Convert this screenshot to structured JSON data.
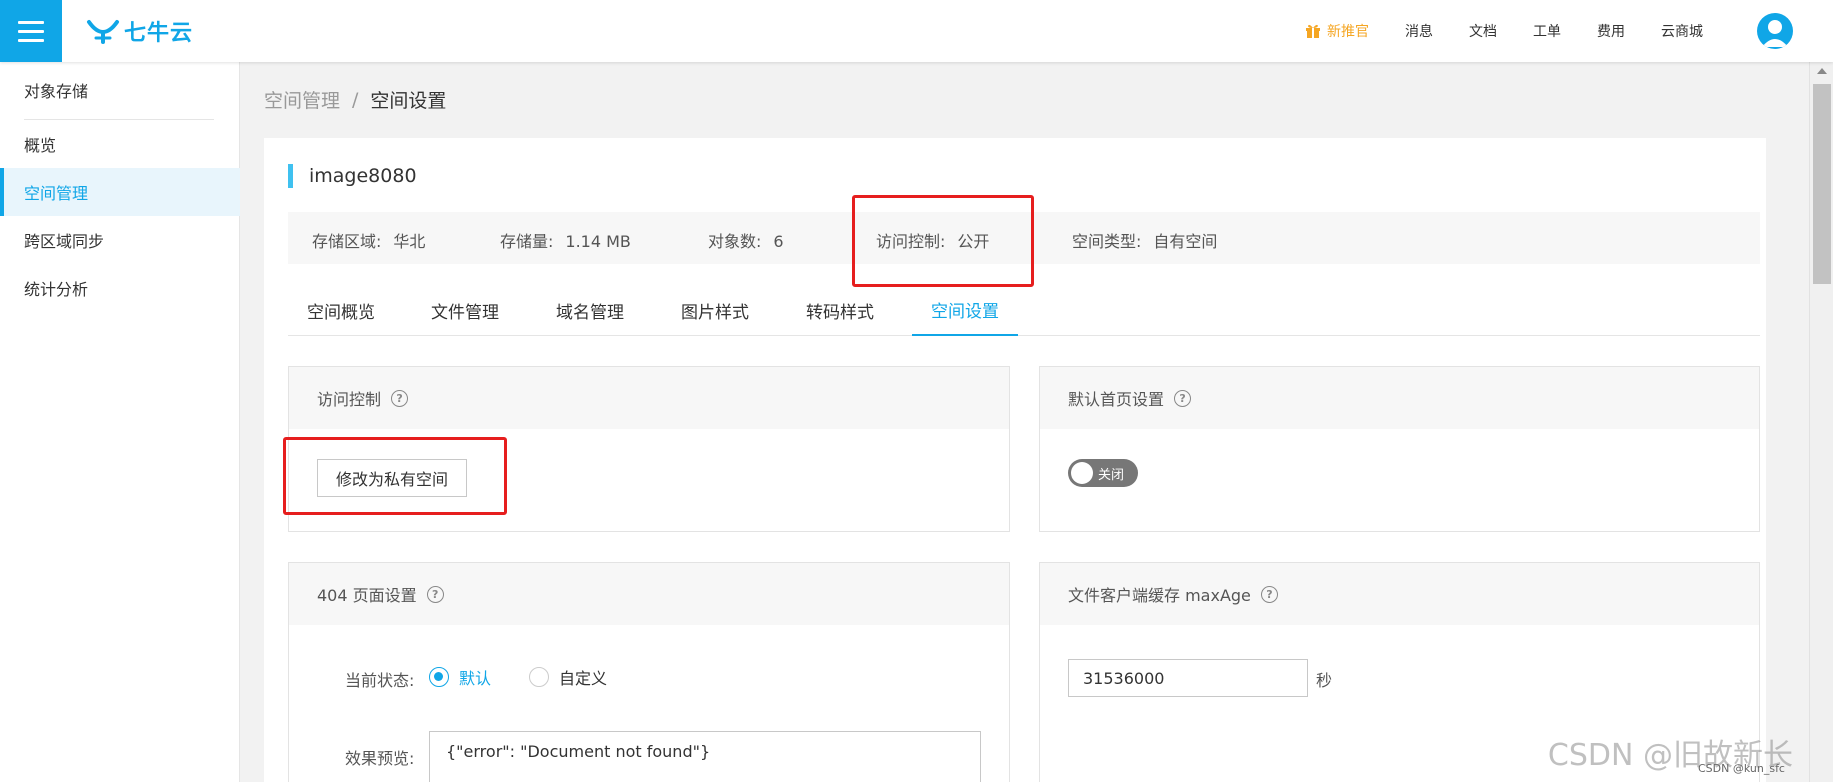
{
  "header": {
    "logo_text": "七牛云",
    "nav": [
      {
        "label": "新推官",
        "promo": true
      },
      {
        "label": "消息"
      },
      {
        "label": "文档"
      },
      {
        "label": "工单"
      },
      {
        "label": "费用"
      },
      {
        "label": "云商城"
      }
    ]
  },
  "sidebar": {
    "title": "对象存储",
    "items": [
      {
        "label": "概览"
      },
      {
        "label": "空间管理",
        "active": true
      },
      {
        "label": "跨区域同步"
      },
      {
        "label": "统计分析"
      }
    ]
  },
  "breadcrumb": {
    "parent": "空间管理",
    "separator": "/",
    "current": "空间设置"
  },
  "bucket": {
    "name": "image8080",
    "info": [
      {
        "key": "存储区域:",
        "value": "华北"
      },
      {
        "key": "存储量:",
        "value": "1.14 MB"
      },
      {
        "key": "对象数:",
        "value": "6"
      },
      {
        "key": "访问控制:",
        "value": "公开"
      },
      {
        "key": "空间类型:",
        "value": "自有空间"
      }
    ]
  },
  "tabs": [
    {
      "label": "空间概览"
    },
    {
      "label": "文件管理"
    },
    {
      "label": "域名管理"
    },
    {
      "label": "图片样式"
    },
    {
      "label": "转码样式"
    },
    {
      "label": "空间设置",
      "active": true
    }
  ],
  "cards": {
    "access": {
      "title": "访问控制",
      "button": "修改为私有空间"
    },
    "homepage": {
      "title": "默认首页设置",
      "toggle_label": "关闭"
    },
    "page404": {
      "title": "404 页面设置",
      "status_label": "当前状态:",
      "options": [
        "默认",
        "自定义"
      ],
      "selected": "默认",
      "preview_label": "效果预览:",
      "preview_value": "{\"error\": \"Document not found\"}"
    },
    "maxage": {
      "title": "文件客户端缓存 maxAge",
      "value": "31536000",
      "unit": "秒"
    }
  },
  "watermark": {
    "main": "CSDN @旧故新长",
    "small": "CSDN @kun_sfc"
  },
  "colors": {
    "accent": "#10a6e7",
    "promo": "#f5a623",
    "highlight": "#e61e1e"
  }
}
